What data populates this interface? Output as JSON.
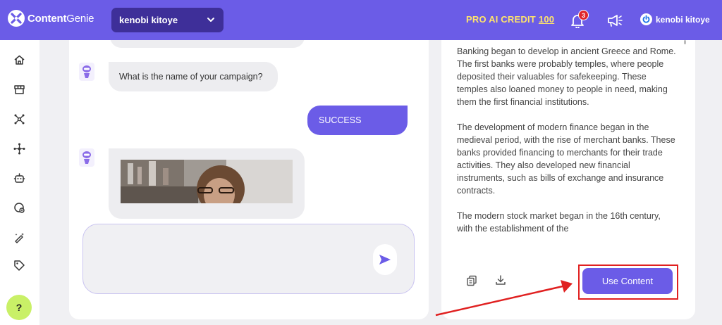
{
  "brand": {
    "name_bold": "Content",
    "name_rest": "Genie"
  },
  "header": {
    "workspace": "kenobi kitoye",
    "credit_label": "PRO AI CREDIT",
    "credit_value": "100",
    "notification_count": "3",
    "user_name": "kenobi kitoye"
  },
  "sidebar": {
    "icons": [
      "home-icon",
      "store-icon",
      "network-icon",
      "nodes-icon",
      "robot-icon",
      "globe-icon",
      "magic-pen-icon",
      "tag-icon"
    ],
    "help_label": "?"
  },
  "chat": {
    "bot_question": "What is the name of your campaign?",
    "user_reply": "SUCCESS",
    "input_placeholder": ""
  },
  "content": {
    "paragraphs": [
      "Banking began to develop in ancient Greece and Rome. The first banks were probably temples, where people deposited their valuables for safekeeping. These temples also loaned money to people in need, making them the first financial institutions.",
      "The development of modern finance began in the medieval period, with the rise of merchant banks. These banks provided financing to merchants for their trade activities. They also developed new financial instruments, such as bills of exchange and insurance contracts.",
      "The modern stock market began in the 16th century, with the establishment of the"
    ],
    "use_button": "Use Content"
  },
  "colors": {
    "primary": "#6b5ce7",
    "credit": "#ffe46b",
    "help": "#c9f067",
    "annotation": "#e02020"
  }
}
